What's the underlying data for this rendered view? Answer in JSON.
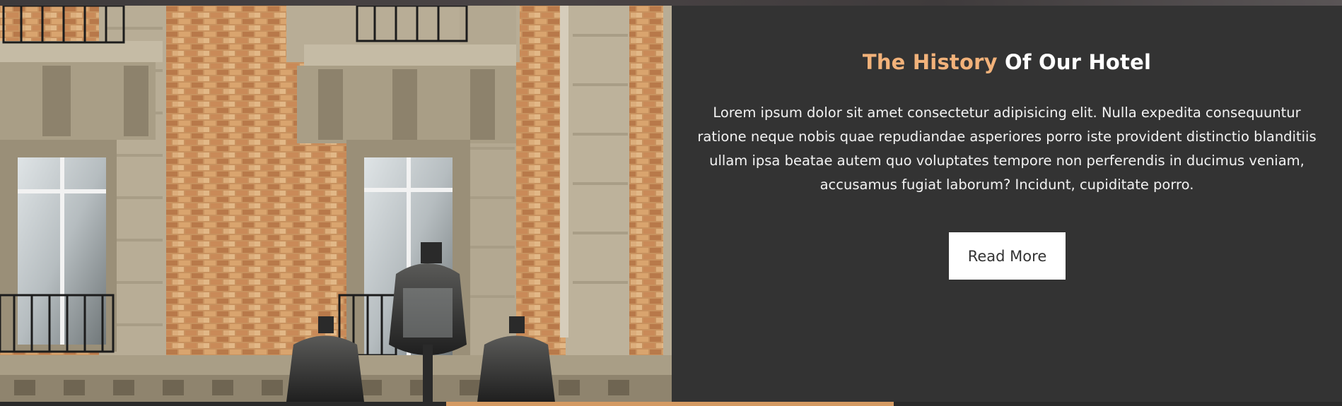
{
  "section": {
    "title_accent": "The History",
    "title_rest": "Of Our Hotel",
    "description": "Lorem ipsum dolor sit amet consectetur adipisicing elit. Nulla expedita consequuntur ratione neque nobis quae repudiandae asperiores porro iste provident distinctio blanditiis ullam ipsa beatae autem quo voluptates tempore non perferendis in ducimus veniam, accusamus fugiat laborum? Incidunt, cupiditate porro.",
    "button_label": "Read More",
    "image": "hotel-building-facade-photo"
  },
  "colors": {
    "panel_background": "#333333",
    "accent": "#f2b27a",
    "button_background": "#ffffff",
    "button_text": "#333333"
  }
}
